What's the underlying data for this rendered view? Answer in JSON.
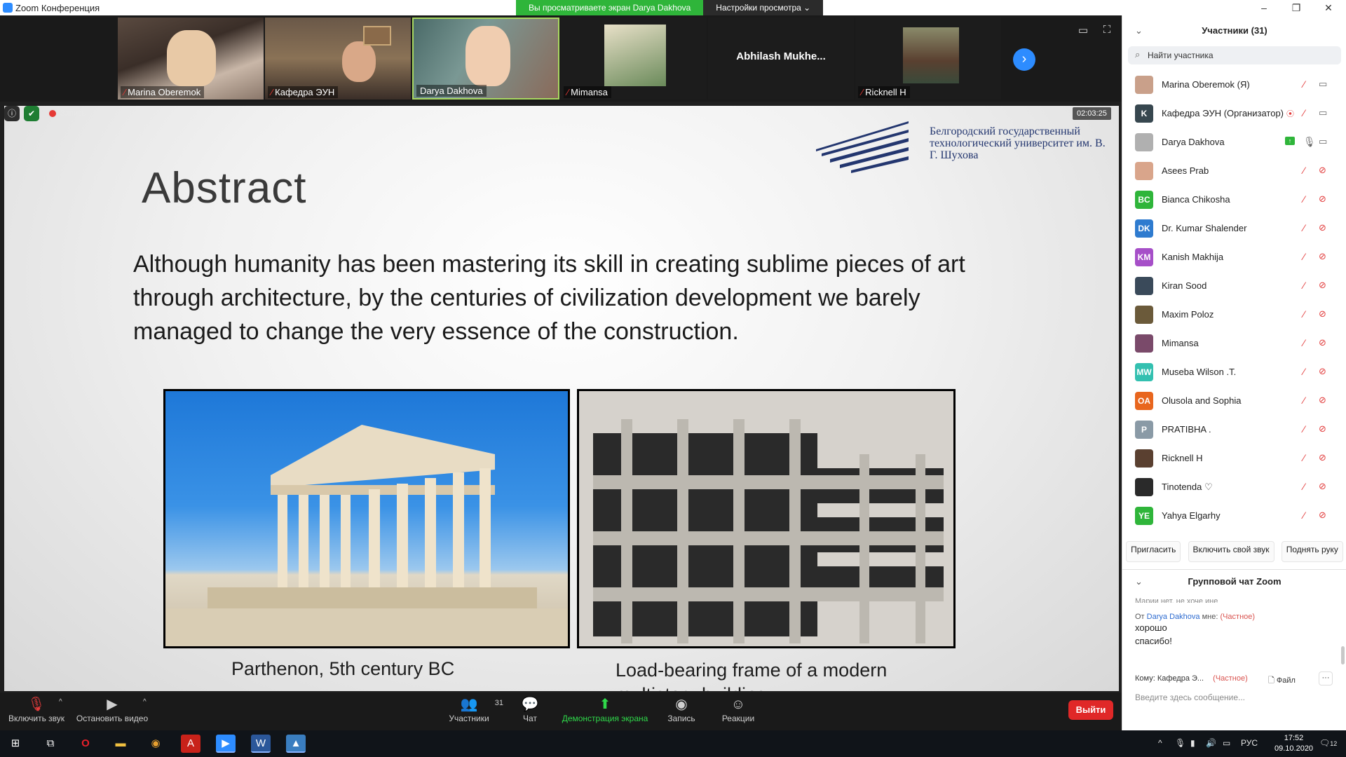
{
  "window": {
    "title": "Zoom Конференция",
    "minimize": "–",
    "maximize": "❐",
    "close": "✕"
  },
  "share_banner": {
    "viewing": "Вы просматриваете экран Darya Dakhova",
    "view_settings": "Настройки просмотра ⌄"
  },
  "video_tiles": [
    {
      "name": "Marina Oberemok",
      "muted": true
    },
    {
      "name": "Кафедра ЭУН",
      "muted": true
    },
    {
      "name": "Darya Dakhova",
      "muted": false
    },
    {
      "name": "Mimansa",
      "muted": true
    },
    {
      "name": "Abhilash  Mukhe...",
      "muted": false
    },
    {
      "name": "Ricknell H",
      "muted": true
    }
  ],
  "recording": {
    "label": "Запись",
    "timer": "02:03:25"
  },
  "slide": {
    "title": "Abstract",
    "university": "Белгородский государственный технологический университет им. В. Г. Шухова",
    "body": "Although humanity has been mastering its skill in creating sublime pieces of art through architecture, by the centuries of civilization development we barely managed to change the very essence of the construction.",
    "caption_left": "Parthenon, 5th century BC",
    "caption_right": "Load-bearing frame of a modern multistory building"
  },
  "toolbar": {
    "unmute": "Включить звук",
    "stop_video": "Остановить видео",
    "participants": "Участники",
    "participants_count": "31",
    "chat": "Чат",
    "share_screen": "Демонстрация экрана",
    "record": "Запись",
    "reactions": "Реакции",
    "leave": "Выйти"
  },
  "panel": {
    "title": "Участники (31)",
    "search_placeholder": "Найти участника",
    "participants": [
      {
        "name": "Marina Oberemok (Я)",
        "initials": "",
        "color": "#c9a08a",
        "mic": "muted",
        "cam": "on"
      },
      {
        "name": "Кафедра ЭУН (Организатор)",
        "initials": "K",
        "color": "#37474f",
        "mic": "muted",
        "cam": "on",
        "host": true
      },
      {
        "name": "Darya Dakhova",
        "initials": "",
        "color": "#b0b0b0",
        "mic": "on",
        "cam": "on",
        "sharing": true
      },
      {
        "name": "Asees Prab",
        "initials": "",
        "color": "#d9a58b",
        "mic": "muted",
        "cam": "off"
      },
      {
        "name": "Bianca Chikosha",
        "initials": "BC",
        "color": "#2fb53a",
        "mic": "muted",
        "cam": "off"
      },
      {
        "name": "Dr. Kumar Shalender",
        "initials": "DK",
        "color": "#2e7bcf",
        "mic": "muted",
        "cam": "off"
      },
      {
        "name": "Kanish Makhija",
        "initials": "KM",
        "color": "#a64fc8",
        "mic": "muted",
        "cam": "off"
      },
      {
        "name": "Kiran Sood",
        "initials": "",
        "color": "#3a4a5a",
        "mic": "muted",
        "cam": "off"
      },
      {
        "name": "Maxim Poloz",
        "initials": "",
        "color": "#6b5a3a",
        "mic": "muted",
        "cam": "off"
      },
      {
        "name": "Mimansa",
        "initials": "",
        "color": "#7a4a6a",
        "mic": "muted",
        "cam": "off"
      },
      {
        "name": "Museba Wilson .T.",
        "initials": "MW",
        "color": "#33c0b0",
        "mic": "muted",
        "cam": "off"
      },
      {
        "name": "Olusola and Sophia",
        "initials": "OA",
        "color": "#e8661e",
        "mic": "muted",
        "cam": "off"
      },
      {
        "name": "PRATIBHA .",
        "initials": "P",
        "color": "#8a9aa6",
        "mic": "muted",
        "cam": "off"
      },
      {
        "name": "Ricknell H",
        "initials": "",
        "color": "#5a4030",
        "mic": "muted",
        "cam": "off"
      },
      {
        "name": "Tinotenda ♡",
        "initials": "",
        "color": "#2a2a2a",
        "mic": "muted",
        "cam": "off"
      },
      {
        "name": "Yahya Elgarhy",
        "initials": "YE",
        "color": "#2fb53a",
        "mic": "muted",
        "cam": "off"
      }
    ],
    "actions": {
      "invite": "Пригласить",
      "unmute_self": "Включить свой звук",
      "raise_hand": "Поднять руку"
    }
  },
  "chat": {
    "title": "Групповой чат Zoom",
    "cut_line": "Марии нет, не хоче ине",
    "from_prefix": "От",
    "sender": "Darya Dakhova",
    "to_me": "мне:",
    "private": "(Частное)",
    "messages": [
      "хорошо",
      "спасибо!"
    ],
    "to_label": "Кому:",
    "to_value": "Кафедра Э...",
    "file": "Файл",
    "more": "···",
    "input_placeholder": "Введите здесь сообщение..."
  },
  "taskbar": {
    "lang": "РУС",
    "time": "17:52",
    "date": "09.10.2020",
    "notifications": "12"
  }
}
